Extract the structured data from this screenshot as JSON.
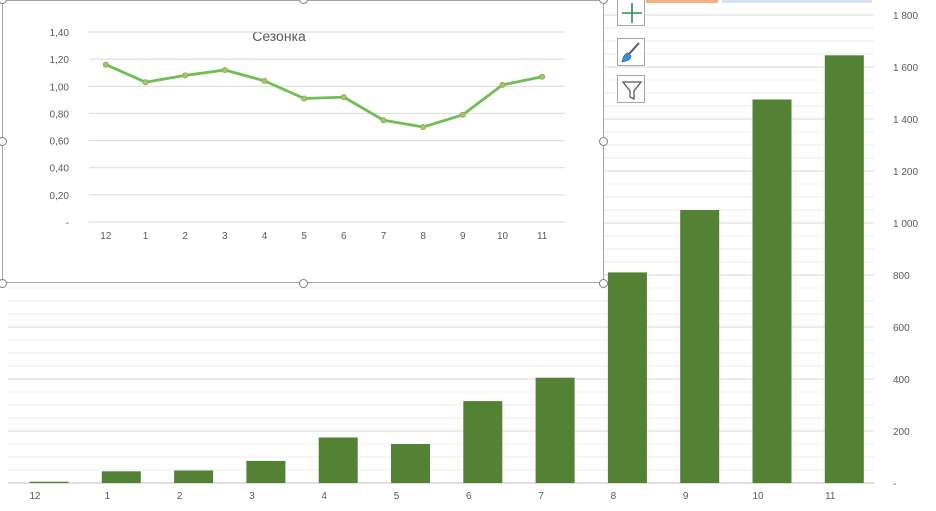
{
  "chart_data": [
    {
      "type": "bar",
      "title": "",
      "categories": [
        "12",
        "1",
        "2",
        "3",
        "4",
        "5",
        "6",
        "7",
        "8",
        "9",
        "10",
        "11"
      ],
      "values": [
        5,
        45,
        48,
        85,
        175,
        150,
        315,
        405,
        810,
        1050,
        1475,
        1645
      ],
      "ylim": [
        0,
        1800
      ],
      "yticks": [
        0,
        200,
        400,
        600,
        800,
        1000,
        1200,
        1400,
        1600,
        1800
      ],
      "ytick_labels": [
        "-",
        "200",
        "400",
        "600",
        "800",
        "1 000",
        "1 200",
        "1 400",
        "1 600",
        "1 800"
      ],
      "axis_side": "right",
      "grid": true,
      "bar_color": "#548235"
    },
    {
      "type": "line",
      "title": "Сезонка",
      "categories": [
        "12",
        "1",
        "2",
        "3",
        "4",
        "5",
        "6",
        "7",
        "8",
        "9",
        "10",
        "11"
      ],
      "values": [
        1.16,
        1.03,
        1.08,
        1.12,
        1.04,
        0.91,
        0.92,
        0.75,
        0.7,
        0.79,
        1.01,
        1.07
      ],
      "ylim": [
        0,
        1.4
      ],
      "yticks": [
        0,
        0.2,
        0.4,
        0.6,
        0.8,
        1.0,
        1.2,
        1.4
      ],
      "ytick_labels": [
        "-",
        "0,20",
        "0,40",
        "0,60",
        "0,80",
        "1,00",
        "1,20",
        "1,40"
      ],
      "grid": true,
      "line_color": "#70bf52",
      "marker_color": "#a9c46b"
    }
  ],
  "side_buttons": [
    {
      "icon": "plus-icon",
      "color": "#2e8b57"
    },
    {
      "icon": "brush-icon",
      "color": "#3c8fd4"
    },
    {
      "icon": "filter-icon",
      "color": "#595959"
    }
  ],
  "colors": {
    "accent_strip_orange": "#f4b183",
    "accent_strip_blue": "#dae3f3"
  }
}
